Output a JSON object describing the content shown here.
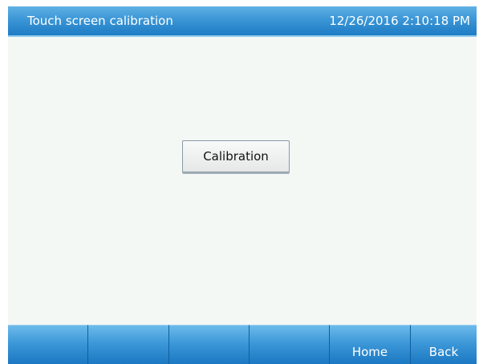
{
  "header": {
    "title": "Touch screen calibration",
    "datetime": "12/26/2016 2:10:18 PM"
  },
  "main": {
    "calibration_button_label": "Calibration"
  },
  "nav": {
    "buttons": [
      {
        "label": ""
      },
      {
        "label": ""
      },
      {
        "label": ""
      },
      {
        "label": ""
      },
      {
        "label": "Home"
      },
      {
        "label": "Back"
      }
    ]
  },
  "colors": {
    "title_bar": "#3b96d6",
    "nav_bar": "#2d89cd",
    "background": "#f3f8f5"
  }
}
